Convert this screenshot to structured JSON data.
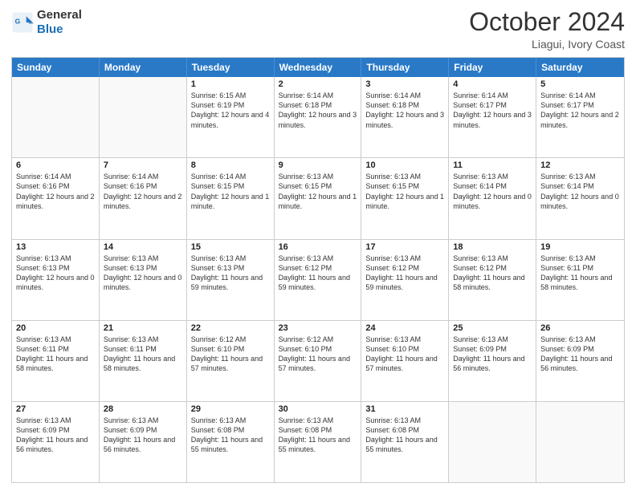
{
  "logo": {
    "text_general": "General",
    "text_blue": "Blue"
  },
  "header": {
    "month": "October 2024",
    "location": "Liagui, Ivory Coast"
  },
  "weekdays": [
    "Sunday",
    "Monday",
    "Tuesday",
    "Wednesday",
    "Thursday",
    "Friday",
    "Saturday"
  ],
  "rows": [
    [
      {
        "day": "",
        "sunrise": "",
        "sunset": "",
        "daylight": "",
        "empty": true
      },
      {
        "day": "",
        "sunrise": "",
        "sunset": "",
        "daylight": "",
        "empty": true
      },
      {
        "day": "1",
        "sunrise": "Sunrise: 6:15 AM",
        "sunset": "Sunset: 6:19 PM",
        "daylight": "Daylight: 12 hours and 4 minutes.",
        "empty": false
      },
      {
        "day": "2",
        "sunrise": "Sunrise: 6:14 AM",
        "sunset": "Sunset: 6:18 PM",
        "daylight": "Daylight: 12 hours and 3 minutes.",
        "empty": false
      },
      {
        "day": "3",
        "sunrise": "Sunrise: 6:14 AM",
        "sunset": "Sunset: 6:18 PM",
        "daylight": "Daylight: 12 hours and 3 minutes.",
        "empty": false
      },
      {
        "day": "4",
        "sunrise": "Sunrise: 6:14 AM",
        "sunset": "Sunset: 6:17 PM",
        "daylight": "Daylight: 12 hours and 3 minutes.",
        "empty": false
      },
      {
        "day": "5",
        "sunrise": "Sunrise: 6:14 AM",
        "sunset": "Sunset: 6:17 PM",
        "daylight": "Daylight: 12 hours and 2 minutes.",
        "empty": false
      }
    ],
    [
      {
        "day": "6",
        "sunrise": "Sunrise: 6:14 AM",
        "sunset": "Sunset: 6:16 PM",
        "daylight": "Daylight: 12 hours and 2 minutes.",
        "empty": false
      },
      {
        "day": "7",
        "sunrise": "Sunrise: 6:14 AM",
        "sunset": "Sunset: 6:16 PM",
        "daylight": "Daylight: 12 hours and 2 minutes.",
        "empty": false
      },
      {
        "day": "8",
        "sunrise": "Sunrise: 6:14 AM",
        "sunset": "Sunset: 6:15 PM",
        "daylight": "Daylight: 12 hours and 1 minute.",
        "empty": false
      },
      {
        "day": "9",
        "sunrise": "Sunrise: 6:13 AM",
        "sunset": "Sunset: 6:15 PM",
        "daylight": "Daylight: 12 hours and 1 minute.",
        "empty": false
      },
      {
        "day": "10",
        "sunrise": "Sunrise: 6:13 AM",
        "sunset": "Sunset: 6:15 PM",
        "daylight": "Daylight: 12 hours and 1 minute.",
        "empty": false
      },
      {
        "day": "11",
        "sunrise": "Sunrise: 6:13 AM",
        "sunset": "Sunset: 6:14 PM",
        "daylight": "Daylight: 12 hours and 0 minutes.",
        "empty": false
      },
      {
        "day": "12",
        "sunrise": "Sunrise: 6:13 AM",
        "sunset": "Sunset: 6:14 PM",
        "daylight": "Daylight: 12 hours and 0 minutes.",
        "empty": false
      }
    ],
    [
      {
        "day": "13",
        "sunrise": "Sunrise: 6:13 AM",
        "sunset": "Sunset: 6:13 PM",
        "daylight": "Daylight: 12 hours and 0 minutes.",
        "empty": false
      },
      {
        "day": "14",
        "sunrise": "Sunrise: 6:13 AM",
        "sunset": "Sunset: 6:13 PM",
        "daylight": "Daylight: 12 hours and 0 minutes.",
        "empty": false
      },
      {
        "day": "15",
        "sunrise": "Sunrise: 6:13 AM",
        "sunset": "Sunset: 6:13 PM",
        "daylight": "Daylight: 11 hours and 59 minutes.",
        "empty": false
      },
      {
        "day": "16",
        "sunrise": "Sunrise: 6:13 AM",
        "sunset": "Sunset: 6:12 PM",
        "daylight": "Daylight: 11 hours and 59 minutes.",
        "empty": false
      },
      {
        "day": "17",
        "sunrise": "Sunrise: 6:13 AM",
        "sunset": "Sunset: 6:12 PM",
        "daylight": "Daylight: 11 hours and 59 minutes.",
        "empty": false
      },
      {
        "day": "18",
        "sunrise": "Sunrise: 6:13 AM",
        "sunset": "Sunset: 6:12 PM",
        "daylight": "Daylight: 11 hours and 58 minutes.",
        "empty": false
      },
      {
        "day": "19",
        "sunrise": "Sunrise: 6:13 AM",
        "sunset": "Sunset: 6:11 PM",
        "daylight": "Daylight: 11 hours and 58 minutes.",
        "empty": false
      }
    ],
    [
      {
        "day": "20",
        "sunrise": "Sunrise: 6:13 AM",
        "sunset": "Sunset: 6:11 PM",
        "daylight": "Daylight: 11 hours and 58 minutes.",
        "empty": false
      },
      {
        "day": "21",
        "sunrise": "Sunrise: 6:13 AM",
        "sunset": "Sunset: 6:11 PM",
        "daylight": "Daylight: 11 hours and 58 minutes.",
        "empty": false
      },
      {
        "day": "22",
        "sunrise": "Sunrise: 6:12 AM",
        "sunset": "Sunset: 6:10 PM",
        "daylight": "Daylight: 11 hours and 57 minutes.",
        "empty": false
      },
      {
        "day": "23",
        "sunrise": "Sunrise: 6:12 AM",
        "sunset": "Sunset: 6:10 PM",
        "daylight": "Daylight: 11 hours and 57 minutes.",
        "empty": false
      },
      {
        "day": "24",
        "sunrise": "Sunrise: 6:13 AM",
        "sunset": "Sunset: 6:10 PM",
        "daylight": "Daylight: 11 hours and 57 minutes.",
        "empty": false
      },
      {
        "day": "25",
        "sunrise": "Sunrise: 6:13 AM",
        "sunset": "Sunset: 6:09 PM",
        "daylight": "Daylight: 11 hours and 56 minutes.",
        "empty": false
      },
      {
        "day": "26",
        "sunrise": "Sunrise: 6:13 AM",
        "sunset": "Sunset: 6:09 PM",
        "daylight": "Daylight: 11 hours and 56 minutes.",
        "empty": false
      }
    ],
    [
      {
        "day": "27",
        "sunrise": "Sunrise: 6:13 AM",
        "sunset": "Sunset: 6:09 PM",
        "daylight": "Daylight: 11 hours and 56 minutes.",
        "empty": false
      },
      {
        "day": "28",
        "sunrise": "Sunrise: 6:13 AM",
        "sunset": "Sunset: 6:09 PM",
        "daylight": "Daylight: 11 hours and 56 minutes.",
        "empty": false
      },
      {
        "day": "29",
        "sunrise": "Sunrise: 6:13 AM",
        "sunset": "Sunset: 6:08 PM",
        "daylight": "Daylight: 11 hours and 55 minutes.",
        "empty": false
      },
      {
        "day": "30",
        "sunrise": "Sunrise: 6:13 AM",
        "sunset": "Sunset: 6:08 PM",
        "daylight": "Daylight: 11 hours and 55 minutes.",
        "empty": false
      },
      {
        "day": "31",
        "sunrise": "Sunrise: 6:13 AM",
        "sunset": "Sunset: 6:08 PM",
        "daylight": "Daylight: 11 hours and 55 minutes.",
        "empty": false
      },
      {
        "day": "",
        "sunrise": "",
        "sunset": "",
        "daylight": "",
        "empty": true
      },
      {
        "day": "",
        "sunrise": "",
        "sunset": "",
        "daylight": "",
        "empty": true
      }
    ]
  ]
}
